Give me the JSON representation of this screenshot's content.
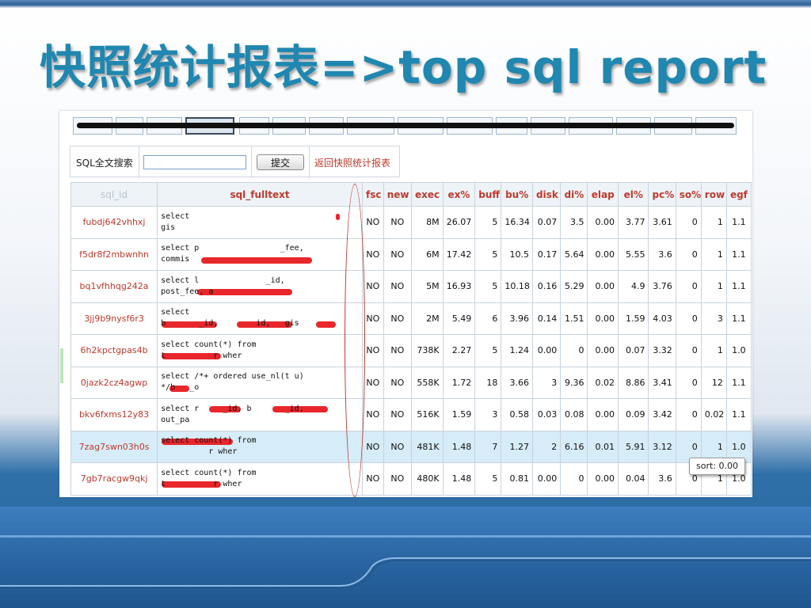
{
  "slide": {
    "title": "快照统计报表=>top sql report"
  },
  "search": {
    "label": "SQL全文搜索",
    "placeholder": "",
    "value": "",
    "submit_label": "提交",
    "back_link": "返回快照统计报表"
  },
  "table": {
    "headers": [
      "sql_id",
      "sql_fulltext",
      "fsc",
      "new",
      "exec",
      "ex%",
      "buff",
      "bu%",
      "disk",
      "di%",
      "elap",
      "el%",
      "pc%",
      "so%",
      "row",
      "egf"
    ],
    "rows": [
      {
        "sql_id": "fubdj642vhhxj",
        "text1": "select",
        "text2": "gis",
        "fsc": "NO",
        "new": "NO",
        "exec": "8M",
        "ex": "26.07",
        "buff": "5",
        "bu": "16.34",
        "disk": "0.07",
        "di": "3.5",
        "elap": "0.00",
        "el": "3.77",
        "pc": "3.61",
        "so": "0",
        "row": "1",
        "egf": "1.1"
      },
      {
        "sql_id": "f5dr8f2mbwnhn",
        "text1": "select p                 _fee,",
        "text2": "commis",
        "fsc": "NO",
        "new": "NO",
        "exec": "6M",
        "ex": "17.42",
        "buff": "5",
        "bu": "10.5",
        "disk": "0.17",
        "di": "5.64",
        "elap": "0.00",
        "el": "5.55",
        "pc": "3.6",
        "so": "0",
        "row": "1",
        "egf": "1.1"
      },
      {
        "sql_id": "bq1vfhhqg242a",
        "text1": "select l              _id,",
        "text2": "post_fee, a",
        "fsc": "NO",
        "new": "NO",
        "exec": "5M",
        "ex": "16.93",
        "buff": "5",
        "bu": "10.18",
        "disk": "0.16",
        "di": "5.29",
        "elap": "0.00",
        "el": "4.9",
        "pc": "3.76",
        "so": "0",
        "row": "1",
        "egf": "1.1"
      },
      {
        "sql_id": "3jj9b9nysf6r3",
        "text1": "select",
        "text2": "b       _id,        id,   gis",
        "fsc": "NO",
        "new": "NO",
        "exec": "2M",
        "ex": "5.49",
        "buff": "6",
        "bu": "3.96",
        "disk": "0.14",
        "di": "1.51",
        "elap": "0.00",
        "el": "1.59",
        "pc": "4.03",
        "so": "0",
        "row": "3",
        "egf": "1.1"
      },
      {
        "sql_id": "6h2kpctgpas4b",
        "text1": "select count(*) from",
        "text2": "t          r wher",
        "fsc": "NO",
        "new": "NO",
        "exec": "738K",
        "ex": "2.27",
        "buff": "5",
        "bu": "1.24",
        "disk": "0.00",
        "di": "0",
        "elap": "0.00",
        "el": "0.07",
        "pc": "3.32",
        "so": "0",
        "row": "1",
        "egf": "1.0"
      },
      {
        "sql_id": "0jazk2cz4agwp",
        "text1": "select /*+ ordered use_nl(t u)",
        "text2": "*/b   _o",
        "fsc": "NO",
        "new": "NO",
        "exec": "558K",
        "ex": "1.72",
        "buff": "18",
        "bu": "3.66",
        "disk": "3",
        "di": "9.36",
        "elap": "0.02",
        "el": "8.86",
        "pc": "3.41",
        "so": "0",
        "row": "12",
        "egf": "1.1"
      },
      {
        "sql_id": "bkv6fxms12y83",
        "text1": "select r     _id, b       _id,",
        "text2": "out_pa",
        "fsc": "NO",
        "new": "NO",
        "exec": "516K",
        "ex": "1.59",
        "buff": "3",
        "bu": "0.58",
        "disk": "0.03",
        "di": "0.08",
        "elap": "0.00",
        "el": "0.09",
        "pc": "3.42",
        "so": "0",
        "row": "0.02",
        "egf": "1.1"
      },
      {
        "sql_id": "7zag7swn03h0s",
        "text1": "select count(*) from",
        "text2": "          r wher",
        "fsc": "NO",
        "new": "NO",
        "exec": "481K",
        "ex": "1.48",
        "buff": "7",
        "bu": "1.27",
        "disk": "2",
        "di": "6.16",
        "elap": "0.01",
        "el": "5.91",
        "pc": "3.12",
        "so": "0",
        "row": "1",
        "egf": "1.0"
      },
      {
        "sql_id": "7gb7racgw9qkj",
        "text1": "select count(*) from",
        "text2": "t          r wher",
        "fsc": "NO",
        "new": "NO",
        "exec": "480K",
        "ex": "1.48",
        "buff": "5",
        "bu": "0.81",
        "disk": "0.00",
        "di": "0",
        "elap": "0.00",
        "el": "0.04",
        "pc": "3.6",
        "so": "0",
        "row": "1",
        "egf": "1.0"
      }
    ]
  },
  "tooltip": {
    "text": "sort: 0.00"
  },
  "colors": {
    "title": "#1f87b0",
    "link_red": "#c0392b",
    "redaction": "#e8262b",
    "highlight_row": "#d6ecf8"
  }
}
